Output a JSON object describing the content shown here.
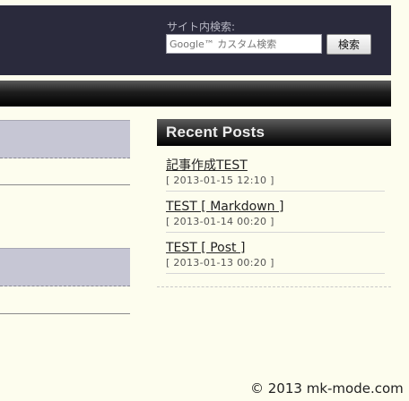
{
  "header": {
    "search_label": "サイト内検索:",
    "search_placeholder": "Google™ カスタム検索",
    "search_button": "検索"
  },
  "sidebar": {
    "title": "Recent Posts",
    "posts": [
      {
        "title": "記事作成TEST",
        "date": "[ 2013-01-15 12:10 ]"
      },
      {
        "title": "TEST [ Markdown ]",
        "date": "[ 2013-01-14 00:20 ]"
      },
      {
        "title": "TEST [ Post ]",
        "date": "[ 2013-01-13 00:20 ]"
      }
    ]
  },
  "footer": {
    "copyright": "© 2013 mk-mode.com"
  }
}
